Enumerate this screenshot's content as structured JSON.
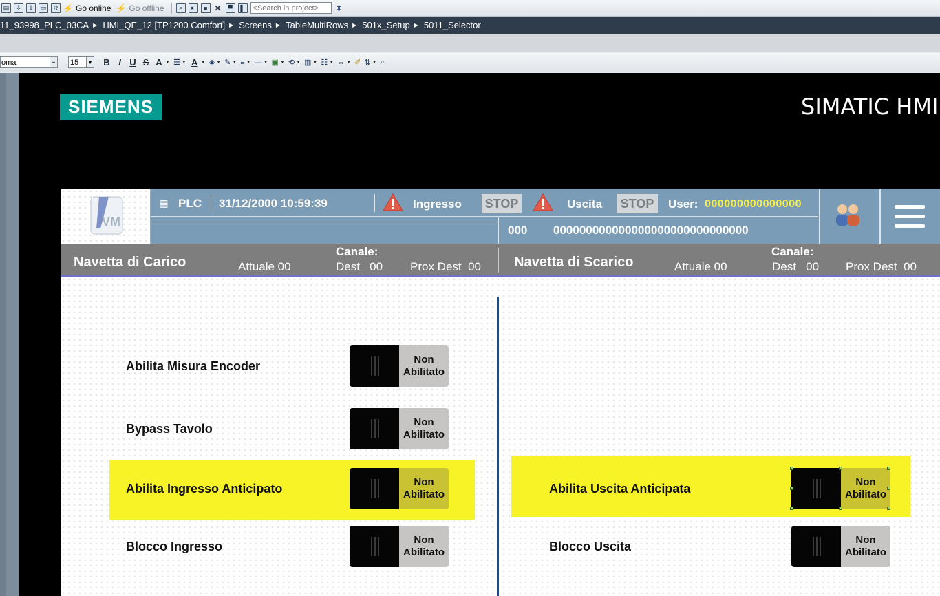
{
  "toolbar": {
    "go_online": "Go online",
    "go_offline": "Go offline",
    "search_placeholder": "<Search in project>"
  },
  "breadcrumb": [
    "11_93998_PLC_03CA",
    "HMI_QE_12 [TP1200 Comfort]",
    "Screens",
    "TableMultiRows",
    "501x_Setup",
    "5011_Selector"
  ],
  "format": {
    "font": "oma",
    "size": "15",
    "bold": "B",
    "italic": "I",
    "underline": "U",
    "strike": "S",
    "text_grow": "A",
    "font_color": "A"
  },
  "editor": {
    "brand": "SIEMENS",
    "panel": "SIMATIC HMI"
  },
  "header": {
    "plc": "PLC",
    "datetime": "31/12/2000 10:59:39",
    "ingresso": "Ingresso",
    "ingresso_state": "STOP",
    "uscita": "Uscita",
    "uscita_state": "STOP",
    "user_label": "User:",
    "user_value": "000000000000000",
    "code_small": "000",
    "code_long": "000000000000000000000000000000"
  },
  "bar": {
    "left": {
      "title": "Navetta di Carico",
      "canale": "Canale:",
      "attuale": "Attuale 00",
      "dest": "Dest   00",
      "prox": "Prox Dest  00"
    },
    "right": {
      "title": "Navetta di Scarico",
      "canale": "Canale:",
      "attuale": "Attuale 00",
      "dest": "Dest   00",
      "prox": "Prox Dest  00"
    }
  },
  "rows": {
    "encoder": {
      "label": "Abilita Misura Encoder",
      "state": "Non\nAbilitato"
    },
    "bypass": {
      "label": "Bypass Tavolo",
      "state": "Non\nAbilitato"
    },
    "ingresso_anticipato": {
      "label": "Abilita Ingresso Anticipato",
      "state": "Non\nAbilitato"
    },
    "blocco_ingresso": {
      "label": "Blocco Ingresso",
      "state": "Non\nAbilitato"
    },
    "uscita_anticipata": {
      "label": "Abilita Uscita Anticipata",
      "state": "Non\nAbilitato"
    },
    "blocco_uscita": {
      "label": "Blocco Uscita",
      "state": "Non\nAbilitato"
    }
  },
  "colors": {
    "highlight": "#f7f327",
    "header_bg": "#7b9cb7",
    "bar_bg": "#7e7e7e",
    "user_value": "#f5f14a"
  }
}
